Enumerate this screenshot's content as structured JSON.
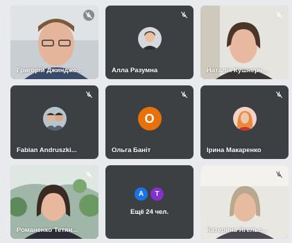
{
  "participants": [
    {
      "name": "Григорій Джинджо...",
      "avatar": "video",
      "muted": true
    },
    {
      "name": "Алла Разумна",
      "avatar": "photo",
      "muted": true
    },
    {
      "name": "Наталія Кушнерч...",
      "avatar": "video",
      "muted": true
    },
    {
      "name": "Fabian Andruszki...",
      "avatar": "photo",
      "muted": true
    },
    {
      "name": "Ольга Баніт",
      "avatar": "letter",
      "letter": "O",
      "avatar_color": "#e8710a",
      "muted": true
    },
    {
      "name": "Ірина Макаренко",
      "avatar": "photo",
      "muted": true
    },
    {
      "name": "Романенко Тетян...",
      "avatar": "video",
      "muted": true
    },
    {
      "name": "Катерина Ягельс...",
      "avatar": "video",
      "muted": true
    }
  ],
  "more_tile": {
    "label": "Ещё 24 чел.",
    "avatars": [
      {
        "letter": "A",
        "color": "#1a73e8"
      },
      {
        "letter": "T",
        "color": "#8430ce"
      }
    ]
  },
  "icons": {
    "mute": "mic-off-icon"
  },
  "colors": {
    "tile_bg": "#3c4043",
    "page_bg": "#e8eaed"
  }
}
